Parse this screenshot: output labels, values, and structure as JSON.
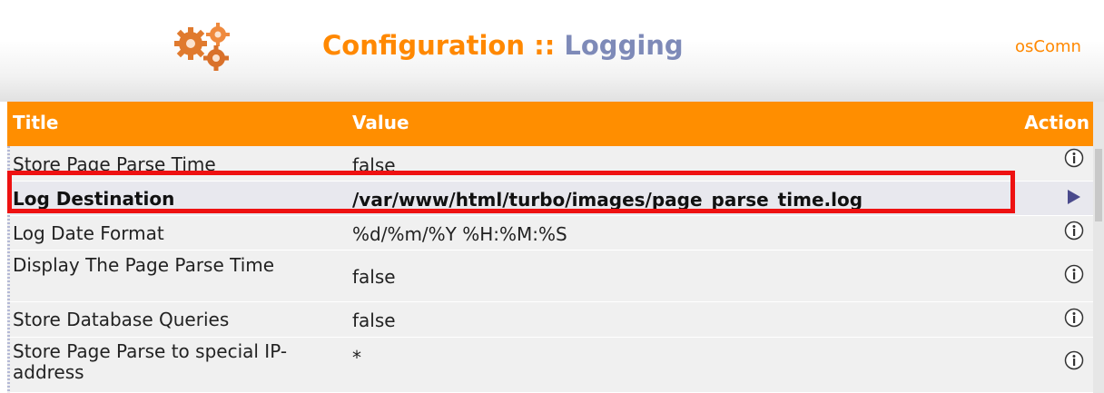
{
  "header": {
    "section": "Configuration ::",
    "subsection": "Logging",
    "link_text": "osComn"
  },
  "table": {
    "columns": {
      "title": "Title",
      "value": "Value",
      "action": "Action"
    },
    "rows": [
      {
        "title": "Store Page Parse Time",
        "value": "false",
        "action_icon": "info-icon",
        "selected": false
      },
      {
        "title": "Log Destination",
        "value": "/var/www/html/turbo/images/page_parse_time.log",
        "action_icon": "arrow-right-icon",
        "selected": true
      },
      {
        "title": "Log Date Format",
        "value": "%d/%m/%Y %H:%M:%S",
        "action_icon": "info-icon",
        "selected": false
      },
      {
        "title": "Display The Page Parse Time",
        "value": "false",
        "action_icon": "info-icon",
        "selected": false
      },
      {
        "title": "Store Database Queries",
        "value": "false",
        "action_icon": "info-icon",
        "selected": false
      },
      {
        "title": "Store Page Parse to special IP-address",
        "value": "*",
        "action_icon": "info-icon",
        "selected": false
      }
    ]
  },
  "colors": {
    "accent_orange": "#ff8e00",
    "title_blue": "#7e8ab8",
    "highlight_red": "#ee1111",
    "row_bg": "#f0f0f0"
  }
}
